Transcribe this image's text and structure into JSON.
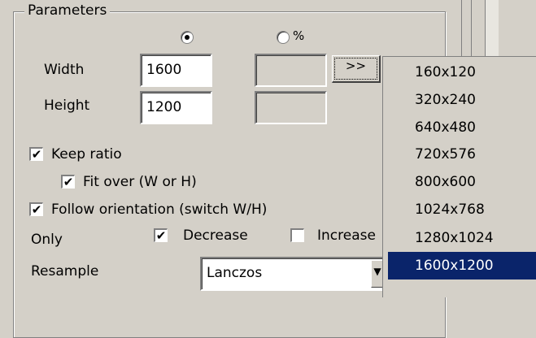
{
  "parameters": {
    "group_title": "Parameters",
    "percent_label": "%",
    "width_label": "Width",
    "width_value": "1600",
    "height_label": "Height",
    "height_value": "1200",
    "pick_button_label": ">>",
    "keep_ratio_label": "Keep ratio",
    "keep_ratio_checked": true,
    "fit_over_label": "Fit over (W or H)",
    "fit_over_checked": true,
    "follow_orientation_label": "Follow orientation (switch W/H)",
    "follow_orientation_checked": true,
    "only_label": "Only",
    "decrease_label": "Decrease",
    "decrease_checked": true,
    "increase_label": "Increase",
    "increase_checked": false,
    "resample_label": "Resample",
    "resample_value": "Lanczos"
  },
  "size_presets": {
    "items": [
      "160x120",
      "320x240",
      "640x480",
      "720x576",
      "800x600",
      "1024x768",
      "1280x1024",
      "1600x1200"
    ],
    "selected": "1600x1200"
  },
  "colors": {
    "face": "#d4d0c8",
    "selection": "#0a246a"
  }
}
